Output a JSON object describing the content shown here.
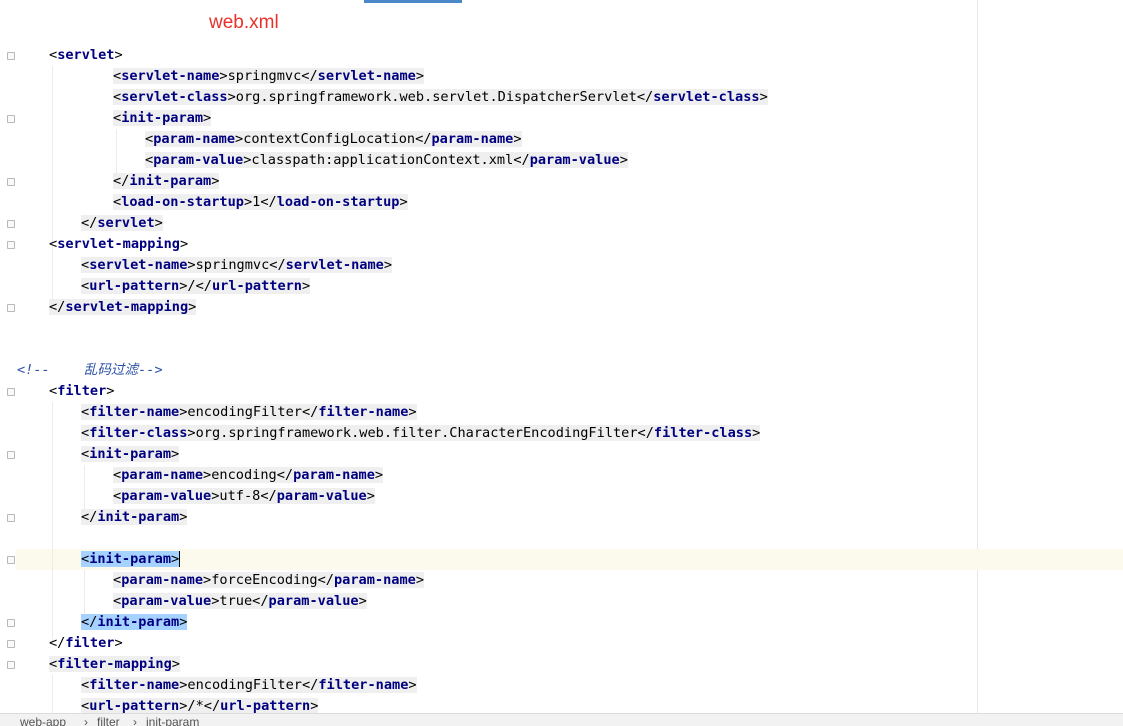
{
  "annotation": {
    "title": "web.xml"
  },
  "editor": {
    "lines": [
      {
        "open": "<",
        "tag": "servlet",
        "close": ">"
      },
      {
        "open": "<",
        "tag": "servlet-name",
        "close": ">",
        "text": "springmvc",
        "eopen": "</",
        "etag": "servlet-name",
        "eclose": ">"
      },
      {
        "open": "<",
        "tag": "servlet-class",
        "close": ">",
        "text": "org.springframework.web.servlet.DispatcherServlet",
        "eopen": "</",
        "etag": "servlet-class",
        "eclose": ">"
      },
      {
        "open": "<",
        "tag": "init-param",
        "close": ">"
      },
      {
        "open": "<",
        "tag": "param-name",
        "close": ">",
        "text": "contextConfigLocation",
        "eopen": "</",
        "etag": "param-name",
        "eclose": ">"
      },
      {
        "open": "<",
        "tag": "param-value",
        "close": ">",
        "text": "classpath:applicationContext.xml",
        "eopen": "</",
        "etag": "param-value",
        "eclose": ">"
      },
      {
        "open": "</",
        "tag": "init-param",
        "close": ">"
      },
      {
        "open": "<",
        "tag": "load-on-startup",
        "close": ">",
        "text": "1",
        "eopen": "</",
        "etag": "load-on-startup",
        "eclose": ">"
      },
      {
        "open": "</",
        "tag": "servlet",
        "close": ">"
      },
      {
        "open": "<",
        "tag": "servlet-mapping",
        "close": ">"
      },
      {
        "open": "<",
        "tag": "servlet-name",
        "close": ">",
        "text": "springmvc",
        "eopen": "</",
        "etag": "servlet-name",
        "eclose": ">"
      },
      {
        "open": "<",
        "tag": "url-pattern",
        "close": ">",
        "text": "/",
        "eopen": "</",
        "etag": "url-pattern",
        "eclose": ">"
      },
      {
        "open": "</",
        "tag": "servlet-mapping",
        "close": ">"
      },
      {
        "comment_open": "<!--",
        "comment_text": "乱码过滤",
        "comment_close": "-->"
      },
      {
        "open": "<",
        "tag": "filter",
        "close": ">"
      },
      {
        "open": "<",
        "tag": "filter-name",
        "close": ">",
        "text": "encodingFilter",
        "eopen": "</",
        "etag": "filter-name",
        "eclose": ">"
      },
      {
        "open": "<",
        "tag": "filter-class",
        "close": ">",
        "text": "org.springframework.web.filter.CharacterEncodingFilter",
        "eopen": "</",
        "etag": "filter-class",
        "eclose": ">"
      },
      {
        "open": "<",
        "tag": "init-param",
        "close": ">"
      },
      {
        "open": "<",
        "tag": "param-name",
        "close": ">",
        "text": "encoding",
        "eopen": "</",
        "etag": "param-name",
        "eclose": ">"
      },
      {
        "open": "<",
        "tag": "param-value",
        "close": ">",
        "text": "utf-8",
        "eopen": "</",
        "etag": "param-value",
        "eclose": ">"
      },
      {
        "open": "</",
        "tag": "init-param",
        "close": ">"
      },
      {
        "open": "<",
        "tag": "init-param",
        "close": ">"
      },
      {
        "open": "<",
        "tag": "param-name",
        "close": ">",
        "text": "forceEncoding",
        "eopen": "</",
        "etag": "param-name",
        "eclose": ">"
      },
      {
        "open": "<",
        "tag": "param-value",
        "close": ">",
        "text": "true",
        "eopen": "</",
        "etag": "param-value",
        "eclose": ">"
      },
      {
        "open": "</",
        "tag": "init-param",
        "close": ">"
      },
      {
        "open": "</",
        "tag": "filter",
        "close": ">"
      },
      {
        "open": "<",
        "tag": "filter-mapping",
        "close": ">"
      },
      {
        "open": "<",
        "tag": "filter-name",
        "close": ">",
        "text": "encodingFilter",
        "eopen": "</",
        "etag": "filter-name",
        "eclose": ">"
      },
      {
        "open": "<",
        "tag": "url-pattern",
        "close": ">",
        "text": "/*",
        "eopen": "</",
        "etag": "url-pattern",
        "eclose": ">"
      }
    ]
  },
  "breadcrumb": [
    "web-app",
    "filter",
    "init-param"
  ],
  "colors": {
    "tag": "#000080",
    "comment": "#2c52a8",
    "annotation": "#e8322b",
    "selection": "#a6d2ff",
    "current_line": "#fcfaed"
  }
}
